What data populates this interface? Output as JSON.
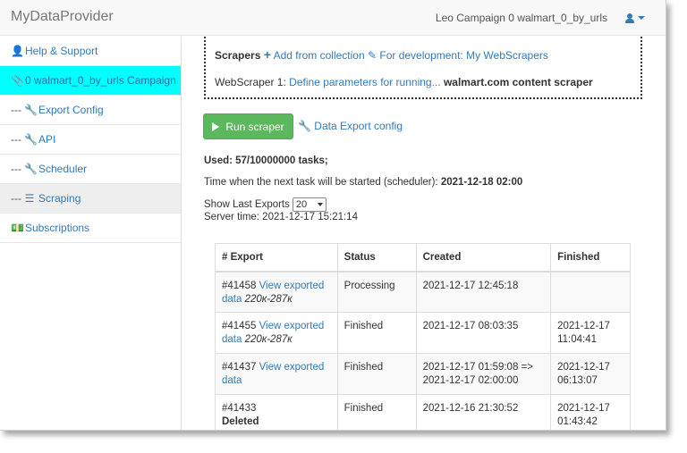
{
  "navbar": {
    "brand": "MyDataProvider",
    "campaign_label": "Leo Campaign 0 walmart_0_by_urls"
  },
  "sidebar": {
    "items": [
      {
        "label": "Help & Support",
        "prefix": "",
        "icon": "user-icon"
      },
      {
        "label": "0 walmart_0_by_urls Campaign",
        "prefix": "",
        "icon": "paperclip-icon"
      },
      {
        "label": "Export Config",
        "prefix": "---",
        "icon": "wrench-icon"
      },
      {
        "label": "API",
        "prefix": "---",
        "icon": "wrench-icon"
      },
      {
        "label": "Scheduler",
        "prefix": "---",
        "icon": "wrench-icon"
      },
      {
        "label": "Scraping",
        "prefix": "---",
        "icon": "tasks-icon"
      },
      {
        "label": "Subscriptions",
        "prefix": "",
        "icon": "money-icon"
      }
    ]
  },
  "scrapers": {
    "heading": "Scrapers",
    "add_label": "Add from collection",
    "dev_label": "For development: My WebScrapers",
    "ws_prefix": "WebScraper 1:",
    "ws_link": "Define parameters for running...",
    "ws_name": "walmart.com content scraper"
  },
  "actions": {
    "run_label": "Run scraper",
    "export_config_label": "Data Export config"
  },
  "info": {
    "used_label": "Used: 57/10000000 tasks;",
    "next_task_label": "Time when the next task will be started (scheduler):",
    "next_task_value": "2021-12-18 02:00",
    "show_last_label": "Show Last Exports",
    "show_last_value": "20",
    "server_time": "Server time: 2021-12-17 15:21:14"
  },
  "table": {
    "headers": [
      "# Export",
      "Status",
      "Created",
      "Finished"
    ],
    "rows": [
      {
        "id": "#41458",
        "link": "View exported",
        "link2": "data",
        "range": "220к-287к",
        "deleted": "",
        "status": "Processing",
        "created": "2021-12-17 12:45:18",
        "created2": "",
        "finished": "",
        "finished2": ""
      },
      {
        "id": "#41455",
        "link": "View exported",
        "link2": "data",
        "range": "220к-287к",
        "deleted": "",
        "status": "Finished",
        "created": "2021-12-17 08:03:35",
        "created2": "",
        "finished": "2021-12-17",
        "finished2": "11:04:41"
      },
      {
        "id": "#41437",
        "link": "View exported",
        "link2": "data",
        "range": "",
        "deleted": "",
        "status": "Finished",
        "created": "2021-12-17 01:59:08 =>",
        "created2": "2021-12-17 02:00:00",
        "finished": "2021-12-17",
        "finished2": "06:13:07"
      },
      {
        "id": "#41433",
        "link": "",
        "link2": "",
        "range": "",
        "deleted": "Deleted",
        "status": "Finished",
        "created": "2021-12-16 21:30:52",
        "created2": "",
        "finished": "2021-12-17",
        "finished2": "01:43:42"
      }
    ]
  }
}
